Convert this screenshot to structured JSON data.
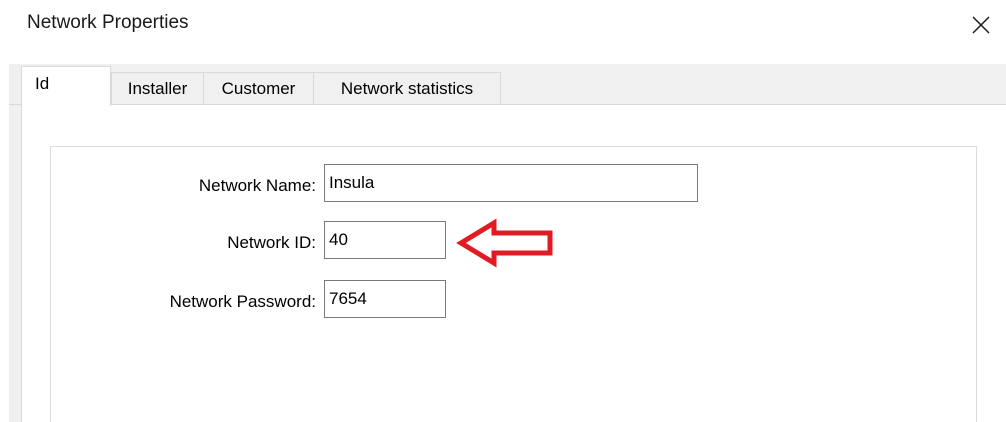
{
  "window": {
    "title": "Network Properties",
    "close_icon": "close-icon"
  },
  "tabs": [
    {
      "label": "Id",
      "active": true
    },
    {
      "label": "Installer",
      "active": false
    },
    {
      "label": "Customer",
      "active": false
    },
    {
      "label": "Network statistics",
      "active": false
    }
  ],
  "form": {
    "network_name_label": "Network Name:",
    "network_name_value": "Insula",
    "network_id_label": "Network ID:",
    "network_id_value": "40",
    "network_password_label": "Network Password:",
    "network_password_value": "7654"
  },
  "annotation": {
    "arrow_icon": "left-arrow-icon",
    "arrow_color": "#e01b24"
  }
}
